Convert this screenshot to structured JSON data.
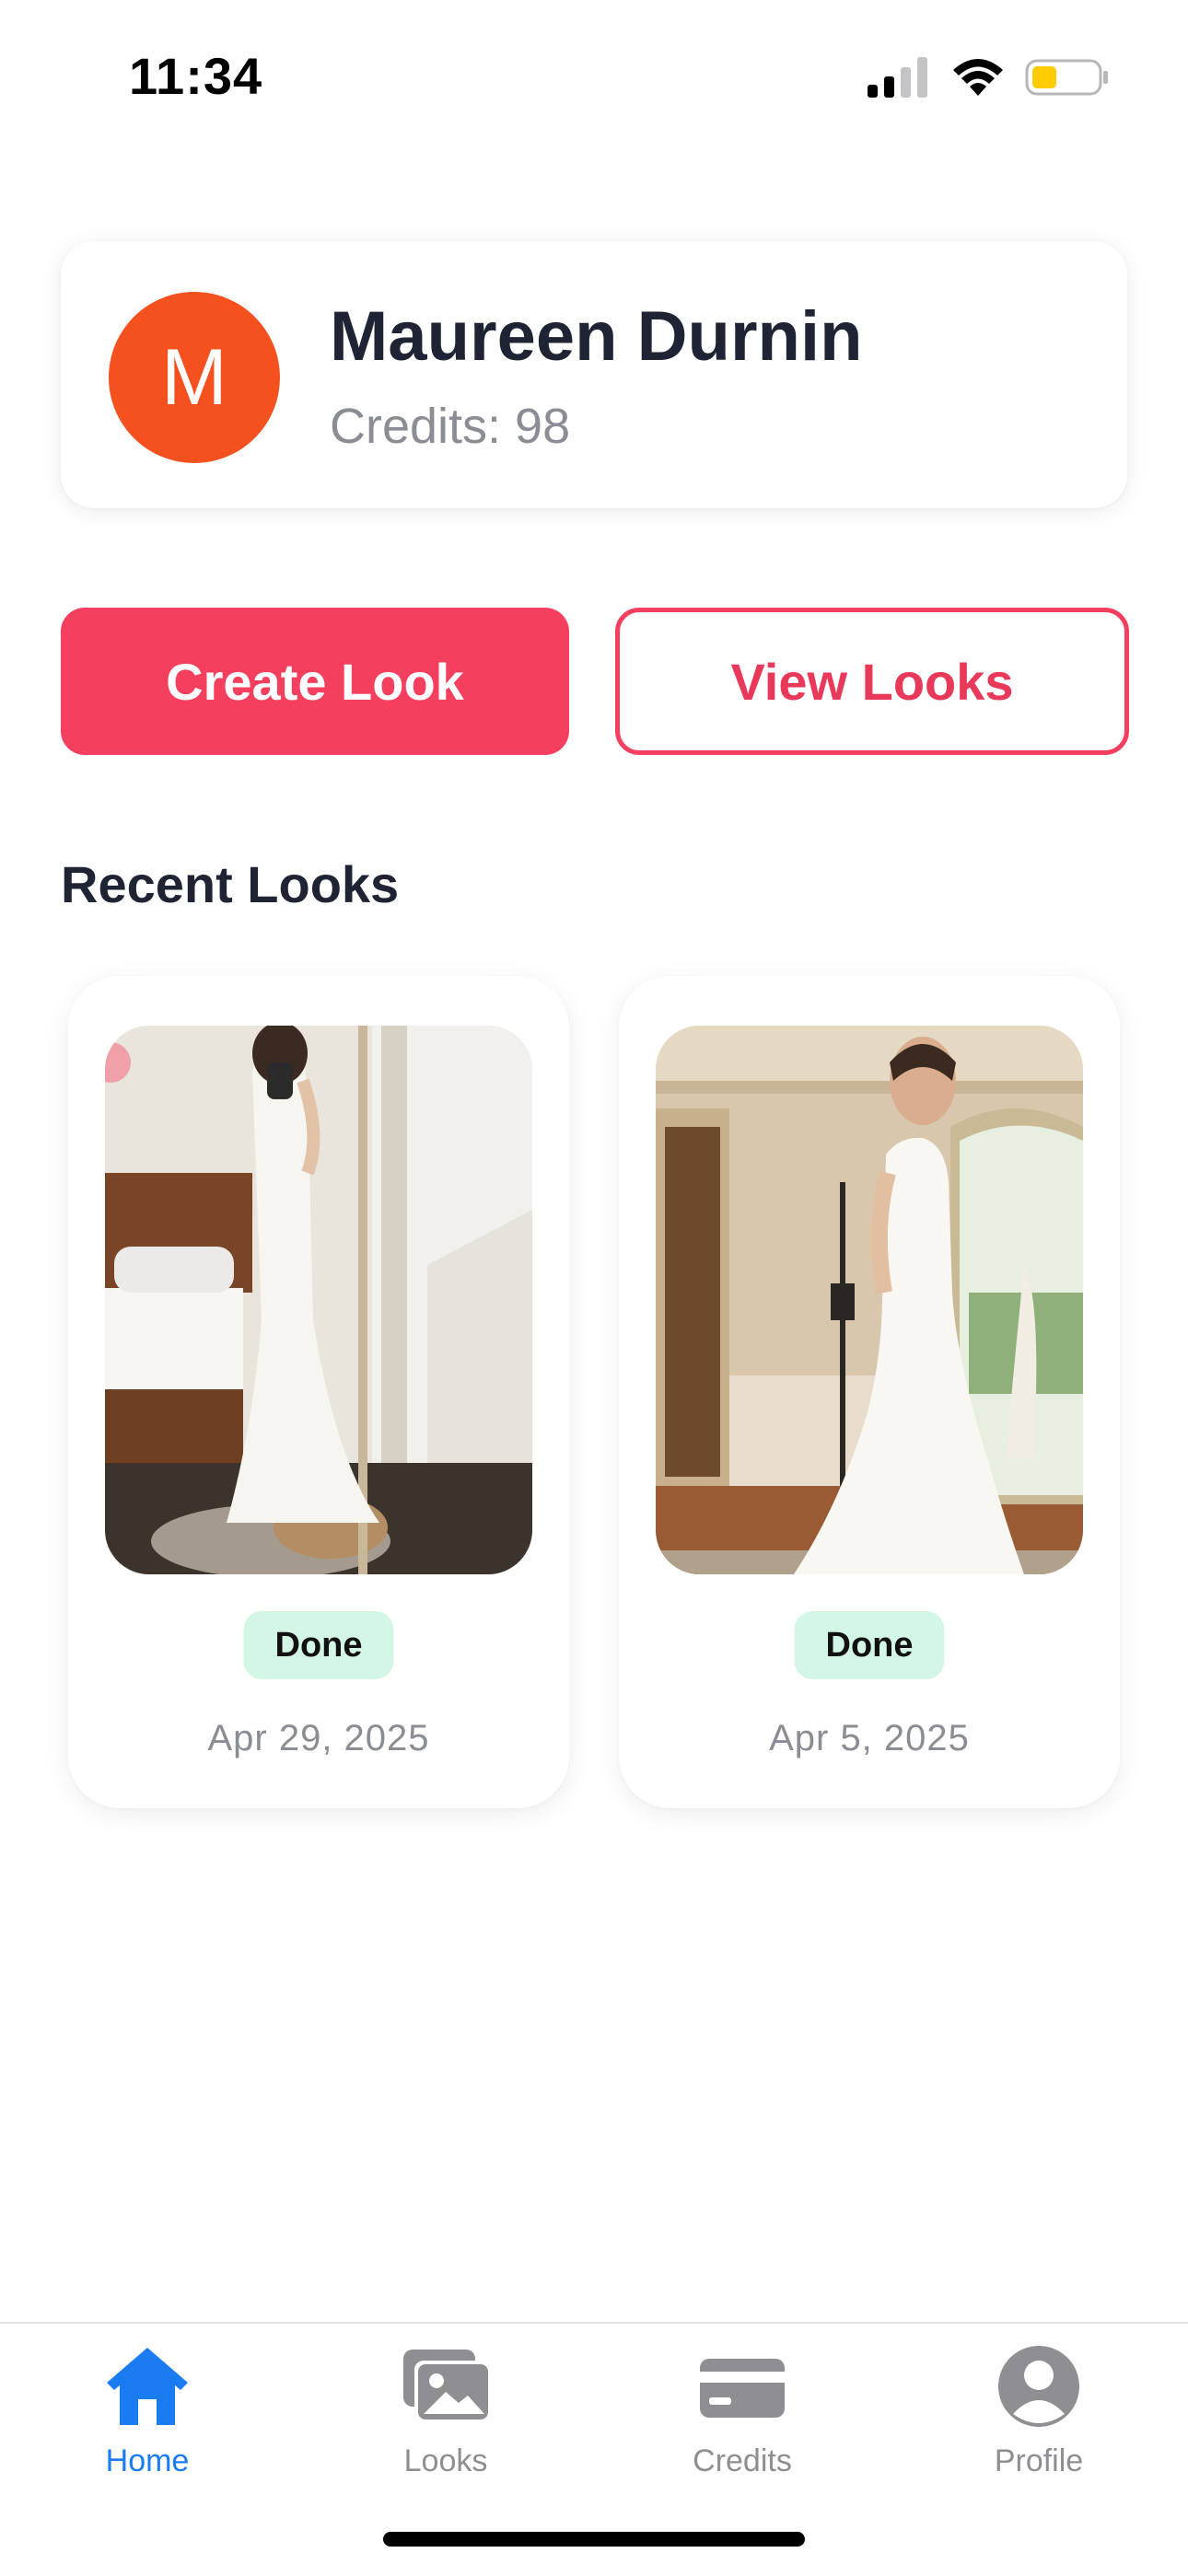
{
  "status_bar": {
    "time": "11:34",
    "signal_icon": "cellular-signal-icon",
    "wifi_icon": "wifi-icon",
    "battery_icon": "battery-low-icon",
    "battery_color": "#ffcc00"
  },
  "profile": {
    "avatar_initial": "M",
    "avatar_color": "#f4511e",
    "name": "Maureen Durnin",
    "credits": "Credits: 98"
  },
  "actions": {
    "create_label": "Create Look",
    "view_label": "View Looks",
    "accent_color": "#f43f5e"
  },
  "recent": {
    "title": "Recent Looks",
    "items": [
      {
        "status": "Done",
        "date": "Apr 29, 2025",
        "image": "bride-dress-photo-bedroom-mirror"
      },
      {
        "status": "Done",
        "date": "Apr 5, 2025",
        "image": "bride-dress-photo-living-room-mirror"
      }
    ]
  },
  "tab_bar": {
    "active_color": "#1a7cf0",
    "inactive_color": "#8e8e93",
    "tabs": [
      {
        "label": "Home",
        "icon": "home-icon",
        "active": true
      },
      {
        "label": "Looks",
        "icon": "photos-icon",
        "active": false
      },
      {
        "label": "Credits",
        "icon": "credit-card-icon",
        "active": false
      },
      {
        "label": "Profile",
        "icon": "person-circle-icon",
        "active": false
      }
    ]
  }
}
